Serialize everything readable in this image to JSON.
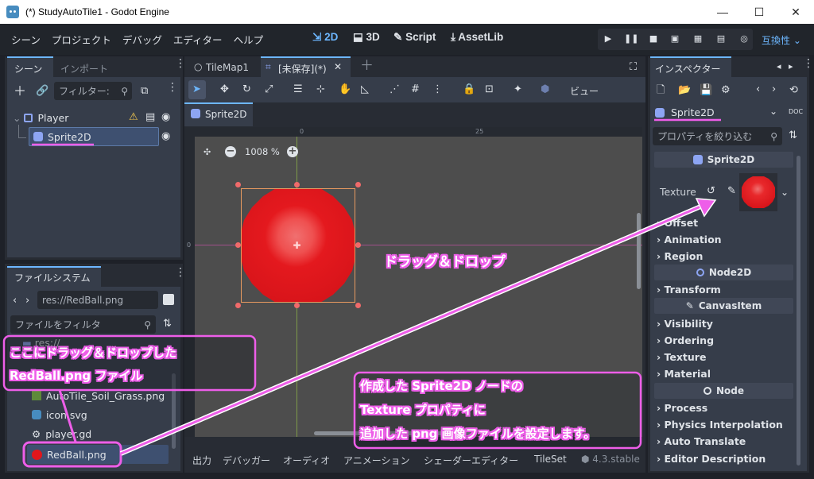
{
  "window": {
    "title": "(*) StudyAutoTile1 - Godot Engine",
    "minimize": "—",
    "maximize": "☐",
    "close": "✕"
  },
  "menu": [
    "シーン",
    "プロジェクト",
    "デバッグ",
    "エディター",
    "ヘルプ"
  ],
  "workspaces": {
    "w2d": "2D",
    "w3d": "3D",
    "script": "Script",
    "assetlib": "AssetLib",
    "active": "2D"
  },
  "renderer": "互換性",
  "scene_dock": {
    "tabs": [
      "シーン",
      "インポート"
    ],
    "filter_placeholder": "フィルター:",
    "tree": [
      {
        "name": "Player",
        "type": "Node2D",
        "warning": true
      },
      {
        "name": "Sprite2D",
        "type": "Sprite2D",
        "selected": true
      }
    ]
  },
  "filesystem": {
    "title": "ファイルシステム",
    "path": "res://RedBall.png",
    "filter_placeholder": "ファイルをフィルタ",
    "items": [
      {
        "name": "res://",
        "kind": "folder"
      },
      {
        "name": "AutoTile_Soil_Grass.png",
        "kind": "png"
      },
      {
        "name": "icon.svg",
        "kind": "svg"
      },
      {
        "name": "player.gd",
        "kind": "gear"
      },
      {
        "name": "RedBall.png",
        "kind": "redball",
        "selected": true
      }
    ]
  },
  "editor_tabs": [
    {
      "label": "TileMap1",
      "active": false
    },
    {
      "label": "[未保存](*)",
      "active": true
    }
  ],
  "scene_tab": "Sprite2D",
  "toolbar": {
    "view_label": "ビュー"
  },
  "viewport": {
    "zoom": "1008 %",
    "ruler_labels": [
      "0",
      "25"
    ],
    "ruler_v_label": "0"
  },
  "bottom_panel": {
    "tabs": [
      "出力",
      "デバッガー",
      "オーディオ",
      "アニメーション",
      "シェーダーエディター",
      "TileSet"
    ],
    "version": "4.3.stable"
  },
  "inspector": {
    "tab": "インスペクター",
    "node": "Sprite2D",
    "filter_placeholder": "プロパティを絞り込む",
    "sections": [
      {
        "kind": "header",
        "label": "Sprite2D",
        "icon": "sprite-icon"
      },
      {
        "kind": "texture",
        "label": "Texture"
      },
      {
        "kind": "group",
        "label": "Offset"
      },
      {
        "kind": "group",
        "label": "Animation"
      },
      {
        "kind": "group",
        "label": "Region"
      },
      {
        "kind": "header",
        "label": "Node2D",
        "icon": "circle-icon"
      },
      {
        "kind": "group",
        "label": "Transform"
      },
      {
        "kind": "header",
        "label": "CanvasItem",
        "icon": "pencil-icon"
      },
      {
        "kind": "group",
        "label": "Visibility"
      },
      {
        "kind": "group",
        "label": "Ordering"
      },
      {
        "kind": "group",
        "label": "Texture"
      },
      {
        "kind": "group",
        "label": "Material"
      },
      {
        "kind": "header",
        "label": "Node",
        "icon": "circle-icon"
      },
      {
        "kind": "group",
        "label": "Process"
      },
      {
        "kind": "group",
        "label": "Physics Interpolation"
      },
      {
        "kind": "group",
        "label": "Auto Translate"
      },
      {
        "kind": "group",
        "label": "Editor Description"
      }
    ]
  },
  "annotations": {
    "drag_drop": "ドラッグ＆ドロップ",
    "left_line1": "ここにドラッグ＆ドロップした",
    "left_line2": "RedBall.png ファイル",
    "right_line1": "作成した Sprite2D ノードの",
    "right_line2": "Texture プロパティに",
    "right_line3": "追加した png 画像ファイルを設定します。"
  },
  "colors": {
    "accent": "#6db7ff",
    "annotation": "#ee5ee9",
    "ball_red": "#e0161c",
    "node_blue": "#8da5f3"
  }
}
